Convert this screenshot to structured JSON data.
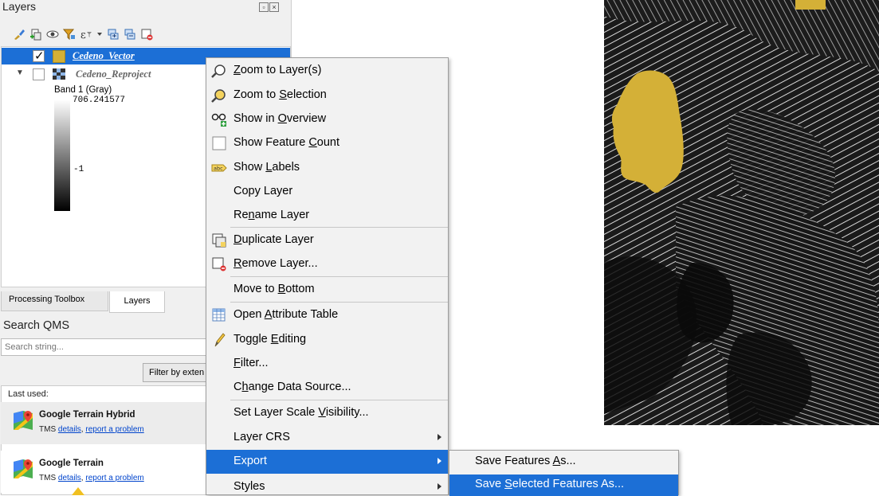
{
  "layers_panel": {
    "title": "Layers",
    "toolbar_icons": [
      "style-brush-icon",
      "add-group-icon",
      "manage-visibility-icon",
      "filter-legend-icon",
      "filter-expression-icon",
      "expand-all-icon",
      "collapse-all-icon",
      "remove-layer-icon"
    ],
    "layers": [
      {
        "name": "Cedeno_Vector",
        "checked": true,
        "selected": true,
        "swatch_color": "#d4b037"
      },
      {
        "name": "Cedeno_Reproject",
        "checked": false,
        "selected": false,
        "band": "Band 1 (Gray)",
        "max": "706.241577",
        "min": "-1"
      }
    ]
  },
  "tabs": [
    "Processing Toolbox",
    "Layers"
  ],
  "qms": {
    "title": "Search QMS",
    "search_placeholder": "Search string...",
    "filter_button": "Filter by exten",
    "last_used_label": "Last used:",
    "services": [
      {
        "name": "Google Terrain Hybrid",
        "type": "TMS",
        "details": "details",
        "report": "report a problem"
      },
      {
        "name": "Google Terrain",
        "type": "TMS",
        "details": "details",
        "report": "report a problem"
      }
    ]
  },
  "context_menu": {
    "zoom_to_layers": [
      "",
      "Z",
      "oom to Layer(s)"
    ],
    "zoom_to_selection": [
      "Zoom to ",
      "S",
      "election"
    ],
    "show_in_overview": [
      "Show in ",
      "O",
      "verview"
    ],
    "show_feature_count": [
      "Show Feature ",
      "C",
      "ount"
    ],
    "show_labels": [
      "Show ",
      "L",
      "abels"
    ],
    "copy_layer": "Copy Layer",
    "rename_layer": [
      "Re",
      "n",
      "ame Layer"
    ],
    "duplicate_layer": [
      "",
      "D",
      "uplicate Layer"
    ],
    "remove_layer": [
      "",
      "R",
      "emove Layer..."
    ],
    "move_to_bottom": [
      "Move to ",
      "B",
      "ottom"
    ],
    "open_attribute_table": [
      "Open ",
      "A",
      "ttribute Table"
    ],
    "toggle_editing": [
      "Toggle ",
      "E",
      "diting"
    ],
    "filter": [
      "",
      "F",
      "ilter..."
    ],
    "change_data_source": [
      "C",
      "h",
      "ange Data Source..."
    ],
    "set_layer_scale_visibility": [
      "Set Layer Scale ",
      "V",
      "isibility..."
    ],
    "layer_crs": "Layer CRS",
    "export": "Export",
    "styles": "Styles"
  },
  "export_submenu": {
    "save_features_as": [
      "Save Features ",
      "A",
      "s..."
    ],
    "save_selected_features_as": [
      "Save ",
      "S",
      "elected Features As..."
    ]
  },
  "colors": {
    "selection_blue": "#1c6fd6",
    "vector_fill": "#d4b037"
  }
}
